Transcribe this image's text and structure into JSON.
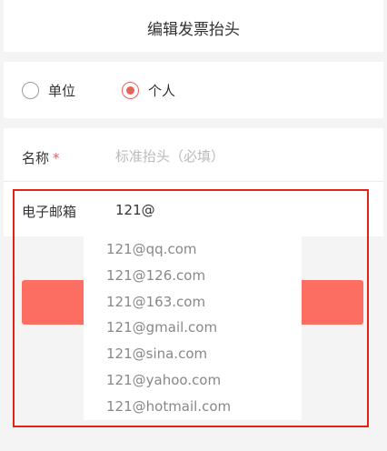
{
  "header": {
    "title": "编辑发票抬头"
  },
  "invoice_type": {
    "options": [
      {
        "label": "单位",
        "checked": false
      },
      {
        "label": "个人",
        "checked": true
      }
    ]
  },
  "form": {
    "name": {
      "label": "名称",
      "required_mark": "*",
      "placeholder": "标准抬头（必填）",
      "value": ""
    },
    "email": {
      "label": "电子邮箱",
      "value": "121@"
    }
  },
  "email_suggestions": [
    "121@qq.com",
    "121@126.com",
    "121@163.com",
    "121@gmail.com",
    "121@sina.com",
    "121@yahoo.com",
    "121@hotmail.com"
  ],
  "colors": {
    "accent": "#e8625a",
    "submit_button": "#fd6e62",
    "highlight": "#e2231a",
    "background": "#f4f4f4"
  }
}
